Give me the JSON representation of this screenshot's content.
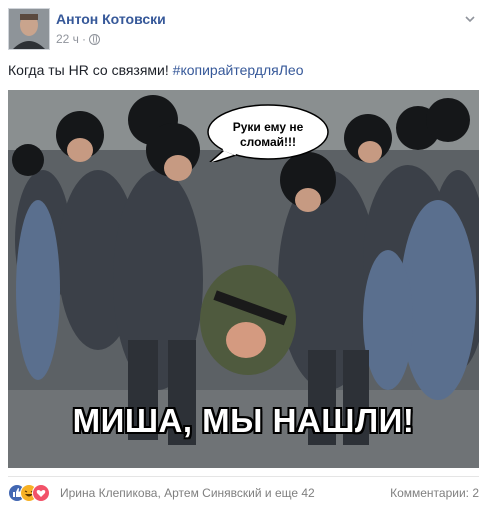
{
  "post": {
    "author": "Антон Котовски",
    "time": "22 ч",
    "separator": "·",
    "text": "Когда ты HR со связями! ",
    "hashtag": "#копирайтердляЛео"
  },
  "photo": {
    "speech_bubble_line1": "Руки ему не",
    "speech_bubble_line2": "сломай!!!",
    "caption": "МИША, МЫ НАШЛИ!"
  },
  "footer": {
    "reactions": [
      "like-icon",
      "haha-icon",
      "love-icon"
    ],
    "names": "Ирина Клепикова, Артем Синявский и еще 42",
    "comments": "Комментарии: 2"
  },
  "colors": {
    "link": "#365899",
    "text": "#1d2129",
    "muted": "#90949c",
    "like": "#4267b2",
    "haha": "#f7b125",
    "love": "#f25268"
  }
}
